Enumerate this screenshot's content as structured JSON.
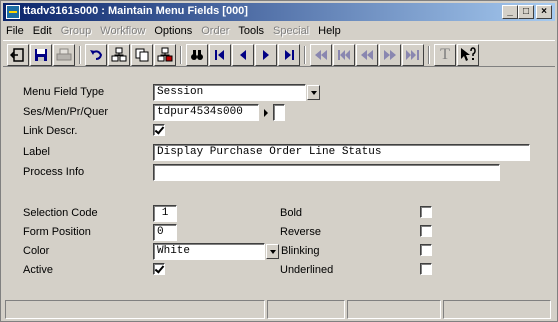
{
  "window": {
    "title": "ttadv3161s000 : Maintain Menu Fields [000]",
    "buttons": {
      "minimize": "_",
      "maximize": "□",
      "close": "×"
    }
  },
  "menubar": [
    {
      "label": "File",
      "enabled": true
    },
    {
      "label": "Edit",
      "enabled": true
    },
    {
      "label": "Group",
      "enabled": false
    },
    {
      "label": "Workflow",
      "enabled": false
    },
    {
      "label": "Options",
      "enabled": true
    },
    {
      "label": "Order",
      "enabled": false
    },
    {
      "label": "Tools",
      "enabled": true
    },
    {
      "label": "Special",
      "enabled": false
    },
    {
      "label": "Help",
      "enabled": true
    }
  ],
  "toolbar": {
    "icons": [
      "exit-icon",
      "save-icon",
      "print-icon",
      "undo-icon",
      "insert-record-icon",
      "copy-record-icon",
      "delete-record-icon",
      "find-icon",
      "first-record-icon",
      "previous-record-icon",
      "next-record-icon",
      "last-record-icon",
      "first-set-icon",
      "previous-group-icon",
      "previous-set-icon",
      "next-set-icon",
      "last-set-icon",
      "text-icon",
      "context-help-icon"
    ],
    "text_button_label": "T"
  },
  "form": {
    "menu_field_type": {
      "label": "Menu Field Type",
      "value": "Session"
    },
    "ses_men_pr_quer": {
      "label": "Ses/Men/Pr/Quer",
      "value": "tdpur4534s000"
    },
    "link_descr": {
      "label": "Link Descr.",
      "checked": true
    },
    "label_field": {
      "label": "Label",
      "value": "Display Purchase Order Line Status"
    },
    "process_info": {
      "label": "Process Info",
      "value": ""
    },
    "selection_code": {
      "label": "Selection Code",
      "value": "1"
    },
    "form_position": {
      "label": "Form Position",
      "value": "0"
    },
    "color": {
      "label": "Color",
      "value": "White"
    },
    "active": {
      "label": "Active",
      "checked": true
    },
    "bold": {
      "label": "Bold",
      "checked": false
    },
    "reverse": {
      "label": "Reverse",
      "checked": false
    },
    "blinking": {
      "label": "Blinking",
      "checked": false
    },
    "underlined": {
      "label": "Underlined",
      "checked": false
    }
  },
  "statusbar": {
    "panels": [
      "",
      "",
      "",
      ""
    ]
  }
}
